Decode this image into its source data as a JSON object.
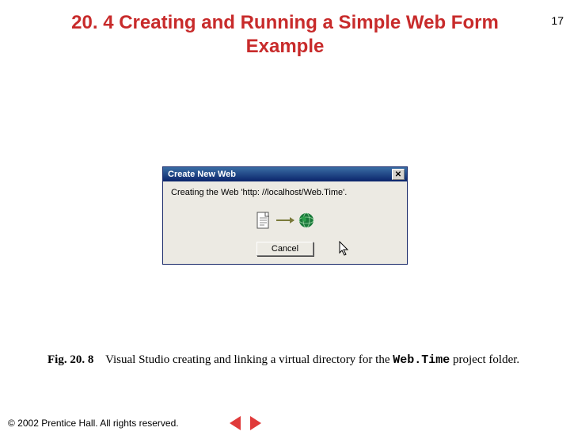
{
  "page_number": "17",
  "heading": "20. 4  Creating and Running a Simple Web Form Example",
  "dialog": {
    "title": "Create New Web",
    "message": "Creating the Web 'http: //localhost/Web.Time'.",
    "cancel_label": "Cancel",
    "icons": {
      "doc": "document-icon",
      "globe": "globe-icon"
    }
  },
  "caption": {
    "fig_num": "Fig. 20. 8",
    "text_before": "Visual Studio creating and linking a virtual directory for the ",
    "code": "Web.Time",
    "text_after": " project folder."
  },
  "footer": {
    "copyright": "© 2002 Prentice Hall.  All rights reserved."
  }
}
